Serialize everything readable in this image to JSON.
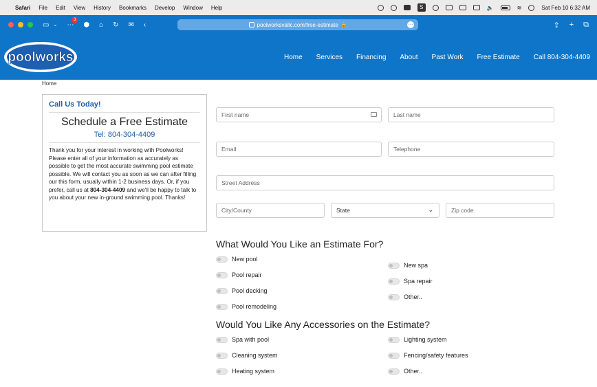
{
  "menubar": {
    "app": "Safari",
    "items": [
      "File",
      "Edit",
      "View",
      "History",
      "Bookmarks",
      "Develop",
      "Window",
      "Help"
    ],
    "datetime": "Sat Feb 10  6:32 AM",
    "s_badge": "S"
  },
  "browser": {
    "url": "poolworksvallc.com/free-estimate",
    "notification_count": "3",
    "icons": [
      "sidebar-icon",
      "chevron-down-icon",
      "extensions-icon",
      "cube-icon",
      "home-icon",
      "reload-icon",
      "mail-icon",
      "back-icon",
      "share-icon",
      "new-tab-icon",
      "tabs-overview-icon"
    ]
  },
  "site": {
    "logo_text": "poolworks",
    "nav": [
      "Home",
      "Services",
      "Financing",
      "About",
      "Past Work",
      "Free Estimate",
      "Call 804-304-4409"
    ],
    "brand_color": "#0e75c9"
  },
  "breadcrumb": "Home",
  "sidebar": {
    "call_us": "Call Us Today!",
    "heading": "Schedule a Free Estimate",
    "tel": "Tel: 804-304-4409",
    "intro_1": "Thank you for your interest in working with Poolworks! Please enter all of your information as accurately as possible to get the most accurate swimming pool estimate possible. We will contact you as soon as we can after filling our this form, usually within 1-2 business days. Or, if you prefer, call us at ",
    "intro_phone": "804-304-4409",
    "intro_2": " and we'll be happy to talk to you about your new in-ground swimming pool. Thanks!"
  },
  "form": {
    "first_name": "First name",
    "last_name": "Last name",
    "email": "Email",
    "telephone": "Telephone",
    "street": "Street Address",
    "city": "City/County",
    "state": "State",
    "zip": "Zip code"
  },
  "estimate": {
    "title": "What Would You Like an Estimate For?",
    "left": [
      "New pool",
      "Pool repair",
      "Pool decking",
      "Pool remodeling"
    ],
    "right": [
      "New spa",
      "Spa repair",
      "Other.."
    ]
  },
  "accessories": {
    "title": "Would You Like Any Accessories on the Estimate?",
    "left": [
      "Spa with pool",
      "Cleaning system",
      "Heating system"
    ],
    "right": [
      "Lighting system",
      "Fencing/safety features",
      "Other.."
    ]
  }
}
